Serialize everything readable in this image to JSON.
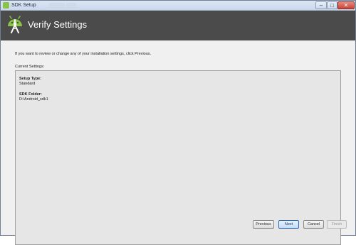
{
  "window": {
    "title": "SDK Setup",
    "close_glyph": "✕",
    "minimize_glyph": "–",
    "maximize_glyph": "□"
  },
  "header": {
    "title": "Verify Settings",
    "logo_icon": "android-studio-logo",
    "background": "#4b4b4b",
    "logo_color": "#8bc34a"
  },
  "main": {
    "intro": "If you want to review or change any of your installation settings, click Previous.",
    "current_settings_label": "Current Settings:",
    "settings": [
      {
        "key": "Setup Type:",
        "value": "Standard"
      },
      {
        "key": "SDK Folder:",
        "value": "D:\\Android_sdk1"
      }
    ]
  },
  "footer": {
    "previous_label": "Previous",
    "next_label": "Next",
    "cancel_label": "Cancel",
    "finish_label": "Finish"
  }
}
